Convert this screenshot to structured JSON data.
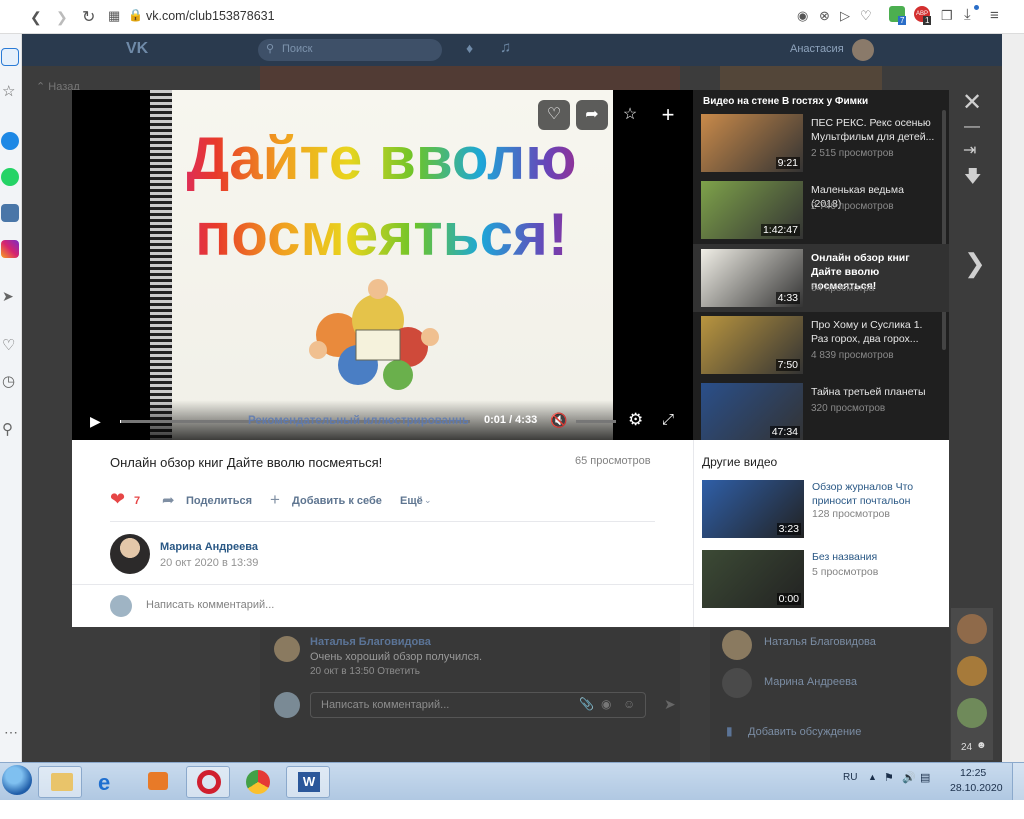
{
  "browser": {
    "url": "vk.com/club153878631",
    "badge_count": "7",
    "abp_count": "1"
  },
  "vk_header": {
    "search_placeholder": "Поиск",
    "user_name": "Анастасия",
    "back_label": "Назад"
  },
  "player": {
    "slide_line1": "Дайте вволю",
    "slide_line2": "посмеяться!",
    "subtitle": "Рекомендательный иллюстрированный список литературы",
    "time": "0:01 / 4:33",
    "progress": 0.004
  },
  "playlist": {
    "header": "Видео на стене В гостях у Фимки",
    "items": [
      {
        "title": "ПЕС РЕКС. Рекс осенью Мультфильм для детей...",
        "views": "2 515 просмотров",
        "duration": "9:21",
        "color": "#c98a4a"
      },
      {
        "title": "Маленькая ведьма (2018)",
        "views": "2 740 просмотров",
        "duration": "1:42:47",
        "color": "#7ea24a"
      },
      {
        "title": "Онлайн обзор книг Дайте вволю посмеяться!",
        "views": "64 просмотра",
        "duration": "4:33",
        "color": "#f0eee6"
      },
      {
        "title": "Про Хому и Суслика 1. Раз горох, два горох...",
        "views": "4 839 просмотров",
        "duration": "7:50",
        "color": "#b9953f"
      },
      {
        "title": "Тайна третьей планеты",
        "views": "320 просмотров",
        "duration": "47:34",
        "color": "#2a4f8a"
      }
    ]
  },
  "info": {
    "title": "Онлайн обзор книг Дайте вволю посмеяться!",
    "views": "65 просмотров",
    "likes": "7",
    "share_label": "Поделиться",
    "add_label": "Добавить к себе",
    "more_label": "Ещё",
    "author": "Марина Андреева",
    "date": "20 окт 2020 в 13:39",
    "comment_placeholder": "Написать комментарий..."
  },
  "other_videos": {
    "header": "Другие видео",
    "items": [
      {
        "title": "Обзор журналов Что приносит почтальон",
        "views": "128 просмотров",
        "duration": "3:23",
        "color": "#2f5fa8"
      },
      {
        "title": "Без названия",
        "views": "5 просмотров",
        "duration": "0:00",
        "color": "#3c4a35"
      }
    ]
  },
  "background_page": {
    "comment_author": "Наталья Благовидова",
    "comment_text": "Очень хороший обзор получился.",
    "comment_meta": "20 окт в 13:50 Ответить",
    "comment_placeholder": "Написать комментарий...",
    "side_name1": "Наталья Благовидова",
    "side_name2": "Марина Андреева",
    "add_discussion": "Добавить обсуждение",
    "online_count": "24"
  },
  "taskbar": {
    "lang": "RU",
    "time": "12:25",
    "date": "28.10.2020"
  },
  "colors": {
    "like": "#e64646",
    "link": "#2a5885",
    "vk_blue": "#4a76a8"
  }
}
